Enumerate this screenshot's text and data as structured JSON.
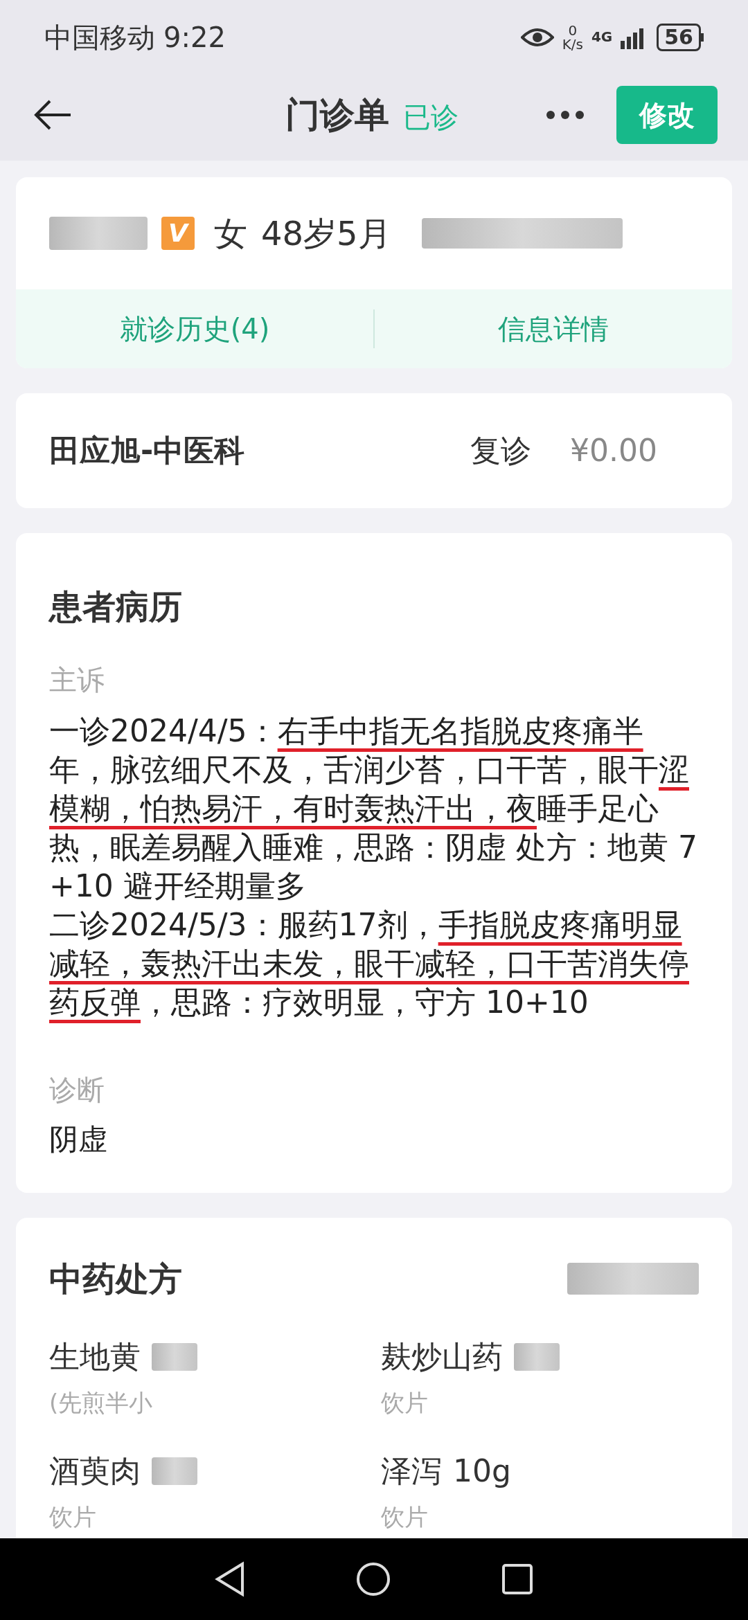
{
  "status_bar": {
    "carrier": "中国移动",
    "time": "9:22",
    "net_speed_value": "0",
    "net_speed_unit": "K/s",
    "network": "4G",
    "battery": "56"
  },
  "header": {
    "title": "门诊单",
    "status": "已诊",
    "edit_button": "修改"
  },
  "patient": {
    "vip_badge": "V",
    "sex": "女",
    "age": "48岁5月",
    "tabs": [
      {
        "label": "就诊历史(4)"
      },
      {
        "label": "信息详情"
      }
    ]
  },
  "visit": {
    "doctor_dept": "田应旭-中医科",
    "visit_type": "复诊",
    "fee": "¥0.00"
  },
  "record": {
    "title": "患者病历",
    "complaint_label": "主诉",
    "complaint": [
      {
        "text": "一诊2024/4/5：",
        "underlined": false
      },
      {
        "text": "右手中指无名指脱皮疼痛半",
        "underlined": true
      },
      {
        "text": "年，脉弦细尺不及，舌润少苔，口干苦，眼干",
        "underlined": false
      },
      {
        "text": "涩模糊，怕热易汗，有时轰热汗出，夜",
        "underlined": true
      },
      {
        "text": "睡手足心热，眠差易醒入睡难，思路：阴虚 处方：地黄 7+10 避开经期量多",
        "underlined": false
      }
    ],
    "complaint_2": [
      {
        "text": "二诊2024/5/3：服药17剂，",
        "underlined": false
      },
      {
        "text": "手指脱皮疼痛明显减轻，轰热汗出未发，眼干减轻，口干苦消失停药反弹",
        "underlined": true
      },
      {
        "text": "，思路：疗效明显，守方 10+10",
        "underlined": false
      }
    ],
    "diagnosis_label": "诊断",
    "diagnosis": "阴虚"
  },
  "prescription": {
    "title": "中药处方",
    "items": [
      {
        "name": "生地黄",
        "note": "(先煎半小"
      },
      {
        "name": "麸炒山药",
        "note": "饮片"
      },
      {
        "name": "酒萸肉",
        "note": "饮片"
      },
      {
        "name": "泽泻",
        "dose": "10g",
        "note": "饮片"
      }
    ]
  }
}
